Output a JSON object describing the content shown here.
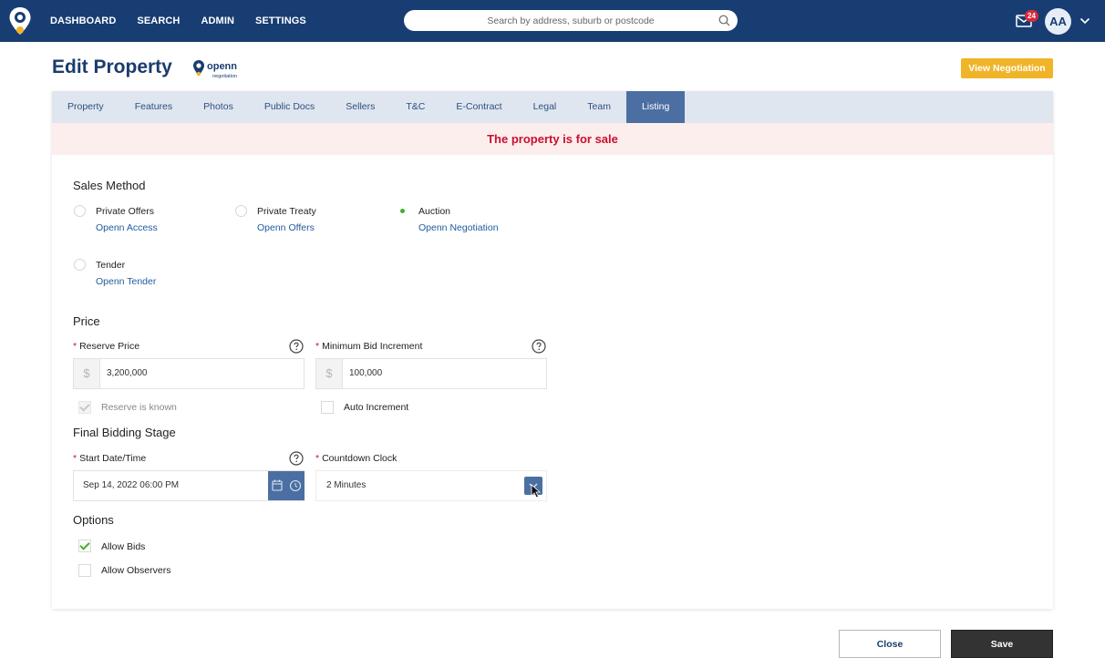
{
  "nav": {
    "links": [
      "DASHBOARD",
      "SEARCH",
      "ADMIN",
      "SETTINGS"
    ],
    "search_placeholder": "Search by address, suburb or postcode",
    "mail_count": "24",
    "avatar_initials": "AA"
  },
  "header": {
    "title": "Edit Property",
    "brand": "openn",
    "brand_sub": "negotiation",
    "view_negotiation": "View Negotiation"
  },
  "tabs": [
    {
      "label": "Property",
      "active": false
    },
    {
      "label": "Features",
      "active": false
    },
    {
      "label": "Photos",
      "active": false
    },
    {
      "label": "Public Docs",
      "active": false
    },
    {
      "label": "Sellers",
      "active": false
    },
    {
      "label": "T&C",
      "active": false
    },
    {
      "label": "E-Contract",
      "active": false
    },
    {
      "label": "Legal",
      "active": false
    },
    {
      "label": "Team",
      "active": false
    },
    {
      "label": "Listing",
      "active": true
    }
  ],
  "banner": "The property is for sale",
  "sales_method": {
    "title": "Sales Method",
    "options": [
      {
        "label": "Private Offers",
        "sub": "Openn Access",
        "selected": false
      },
      {
        "label": "Private Treaty",
        "sub": "Openn Offers",
        "selected": false
      },
      {
        "label": "Auction",
        "sub": "Openn Negotiation",
        "selected": true
      },
      {
        "label": "Tender",
        "sub": "Openn Tender",
        "selected": false
      }
    ]
  },
  "price": {
    "title": "Price",
    "reserve_label": "Reserve Price",
    "reserve_value": "3,200,000",
    "currency": "$",
    "min_bid_label": "Minimum Bid Increment",
    "min_bid_value": "100,000",
    "reserve_known_label": "Reserve is known",
    "reserve_known": true,
    "auto_increment_label": "Auto Increment",
    "auto_increment": false
  },
  "final_stage": {
    "title": "Final Bidding Stage",
    "start_label": "Start Date/Time",
    "start_value": "Sep 14, 2022 06:00 PM",
    "countdown_label": "Countdown Clock",
    "countdown_value": "2 Minutes"
  },
  "options": {
    "title": "Options",
    "allow_bids_label": "Allow Bids",
    "allow_bids": true,
    "allow_observers_label": "Allow Observers",
    "allow_observers": false
  },
  "footer": {
    "close": "Close",
    "save": "Save"
  },
  "colors": {
    "nav_bg": "#173d73",
    "accent": "#4b6fa2",
    "banner_text": "#c8102e",
    "view_btn": "#f0b428",
    "check_green": "#43b02a"
  }
}
